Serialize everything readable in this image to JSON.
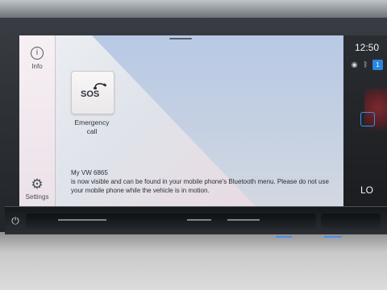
{
  "nav": {
    "info_label": "Info",
    "settings_label": "Settings"
  },
  "main": {
    "sos_icon_text": "SOS",
    "sos_label_line1": "Emergency",
    "sos_label_line2": "call",
    "message_title": "My VW 6865",
    "message_body": "is now visible and can be found in your mobile phone's Bluetooth menu. Please do not use your mobile phone while the vehicle is in motion."
  },
  "status": {
    "time": "12:50",
    "badge_count": "1",
    "climate_label": "LO"
  },
  "icons": {
    "info": "info-icon",
    "settings": "gear-icon",
    "sos": "phone-icon",
    "power": "power-icon",
    "signal": "signal-icon",
    "bluetooth": "bluetooth-icon"
  },
  "colors": {
    "accent": "#2b86e0",
    "panel": "#1b1d20"
  }
}
